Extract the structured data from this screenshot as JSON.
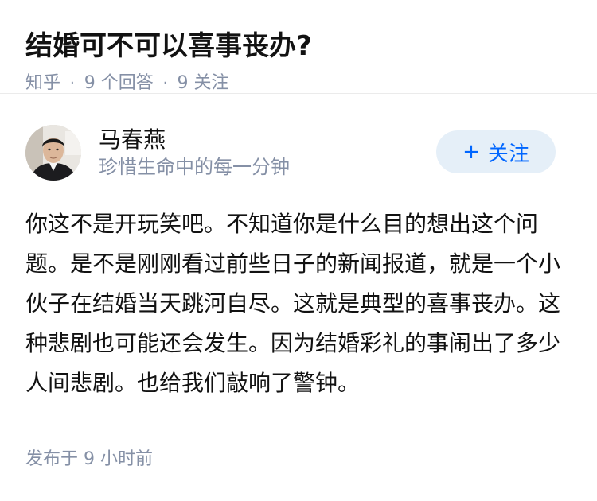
{
  "question": {
    "title": "结婚可不可以喜事丧办?",
    "source": "知乎",
    "answer_count": "9 个回答",
    "follower_count": "9 关注"
  },
  "answer": {
    "author": {
      "name": "马春燕",
      "bio": "珍惜生命中的每一分钟"
    },
    "follow_label": "关注",
    "body": "你这不是开玩笑吧。不知道你是什么目的想出这个问题。是不是刚刚看过前些日子的新闻报道，就是一个小伙子在结婚当天跳河自尽。这就是典型的喜事丧办。这种悲剧也可能还会发生。因为结婚彩礼的事闹出了多少人间悲剧。也给我们敲响了警钟。",
    "published": "发布于 9 小时前"
  },
  "colors": {
    "accent": "#0066ff",
    "follow_bg": "#e5eff8",
    "meta_gray": "#8590a6"
  },
  "icons": {
    "follow": "plus-icon"
  }
}
